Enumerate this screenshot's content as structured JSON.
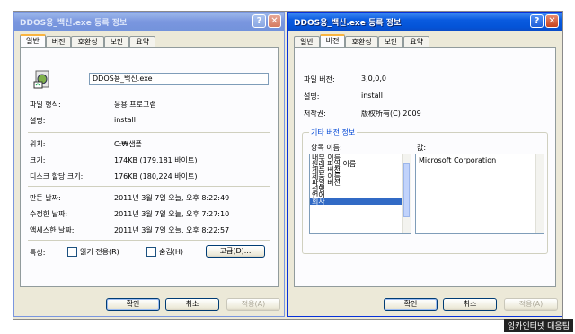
{
  "left": {
    "title": "DDOS용_백신.exe 등록 정보",
    "tabs": [
      "일반",
      "버전",
      "호환성",
      "보안",
      "요약"
    ],
    "filename": "DDOS용_백신.exe",
    "rows": [
      {
        "label": "파일 형식:",
        "value": "응용 프로그램"
      },
      {
        "label": "설명:",
        "value": "install"
      },
      {
        "label": "위치:",
        "value": "C:₩샘플"
      },
      {
        "label": "크기:",
        "value": "174KB (179,181 바이트)"
      },
      {
        "label": "디스크 할당 크기:",
        "value": "176KB (180,224 바이트)"
      },
      {
        "label": "만든 날짜:",
        "value": "2011년 3월 7일 오늘, 오후 8:22:49"
      },
      {
        "label": "수정한 날짜:",
        "value": "2011년 3월 7일 오늘, 오후 7:27:10"
      },
      {
        "label": "액세스한 날짜:",
        "value": "2011년 3월 7일 오늘, 오후 8:22:57"
      }
    ],
    "attr_label": "특성:",
    "readonly_label": "읽기 전용(R)",
    "hidden_label": "숨김(H)",
    "advanced_button": "고급(D)...",
    "ok": "확인",
    "cancel": "취소",
    "apply": "적용(A)"
  },
  "right": {
    "title": "DDOS용_백신.exe 등록 정보",
    "tabs": [
      "일반",
      "버전",
      "호환성",
      "보안",
      "요약"
    ],
    "file_version_label": "파일 버전:",
    "file_version": "3,0,0,0",
    "desc_label": "설명:",
    "desc": "install",
    "copyright_label": "저작권:",
    "copyright": "版权所有(C) 2009",
    "group_label": "기타 버전 정보",
    "item_label": "항목 이름:",
    "value_label": "값:",
    "items": [
      "내부 이름",
      "원래 파일 이름",
      "제품 버전",
      "제품 이름",
      "파일 버전",
      "설명",
      "언어",
      "회사"
    ],
    "value_text": "Microsoft Corporation",
    "ok": "확인",
    "cancel": "취소",
    "apply": "적용(A)"
  },
  "watermark": "잉카인터넷 대응팀",
  "colors": {
    "title_active": "#0a5be0",
    "selection": "#316ac5",
    "face": "#ece9d8"
  }
}
